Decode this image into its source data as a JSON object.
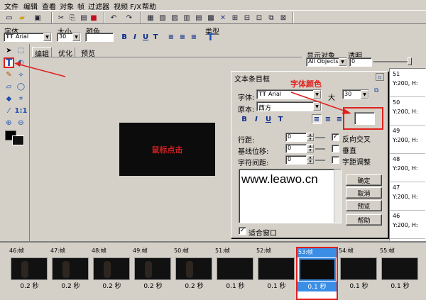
{
  "menu": [
    "文件",
    "编辑",
    "查看",
    "对象",
    "帧",
    "过滤器",
    "视频 F/X",
    "帮助"
  ],
  "props_bar": {
    "font_label": "字体",
    "font_value": "Arial",
    "size_label": "大小",
    "size_value": "30",
    "color_label": "颜色",
    "type_label": "类型",
    "bold": "B",
    "italic": "I",
    "underline": "U",
    "strike": "T"
  },
  "editor_tabs": [
    "编辑",
    "优化",
    "预览"
  ],
  "canvas": {
    "text": "鼠标点击",
    "text_color": "#cc2020"
  },
  "right_panel": {
    "show_obj_label": "显示对象",
    "opacity_label": "透明",
    "show_obj_value": "All Objects",
    "opacity_value": "0",
    "items": [
      {
        "num": "51",
        "val": "Y:200, H:"
      },
      {
        "num": "50",
        "val": "Y:200, H:"
      },
      {
        "num": "49",
        "val": "Y:200, H:"
      },
      {
        "num": "48",
        "val": "Y:200, H:"
      },
      {
        "num": "47",
        "val": "Y:200, H:"
      },
      {
        "num": "46",
        "val": "Y:200, H:"
      }
    ]
  },
  "dialog": {
    "title": "文本条目框",
    "font_label": "字体:",
    "font_value": "Arial",
    "size_label": "大",
    "size_value": "30",
    "script_label": "原本:",
    "script_value": "西方",
    "line_spacing_label": "行距:",
    "line_spacing_value": "0",
    "baseline_label": "基线位移:",
    "baseline_value": "0",
    "char_spacing_label": "字符间距:",
    "char_spacing_value": "0",
    "antialias_label": "反向交叉",
    "vertical_label": "垂直",
    "kerning_label": "字距调整",
    "fit_label": "适合窗口",
    "text": "www.leawo.cn",
    "ok": "确定",
    "cancel": "取消",
    "preview": "预览",
    "help": "帮助",
    "color_annotation": "字体颜色",
    "annotation_color": "#e0201c"
  },
  "frames": [
    {
      "label": "46:帧",
      "time": "0.2 秒",
      "photo": true
    },
    {
      "label": "47:帧",
      "time": "0.2 秒",
      "photo": true
    },
    {
      "label": "48:帧",
      "time": "0.2 秒",
      "photo": true
    },
    {
      "label": "49:帧",
      "time": "0.2 秒",
      "photo": true
    },
    {
      "label": "50:帧",
      "time": "0.2 秒",
      "photo": true
    },
    {
      "label": "51:帧",
      "time": "0.1 秒",
      "photo": false
    },
    {
      "label": "52:帧",
      "time": "0.1 秒",
      "photo": false
    },
    {
      "label": "53:帧",
      "time": "0.1 秒",
      "photo": false,
      "selected": true
    },
    {
      "label": "54:帧",
      "time": "0.1 秒",
      "photo": false
    },
    {
      "label": "55:帧",
      "time": "0.1 秒",
      "photo": false
    }
  ]
}
